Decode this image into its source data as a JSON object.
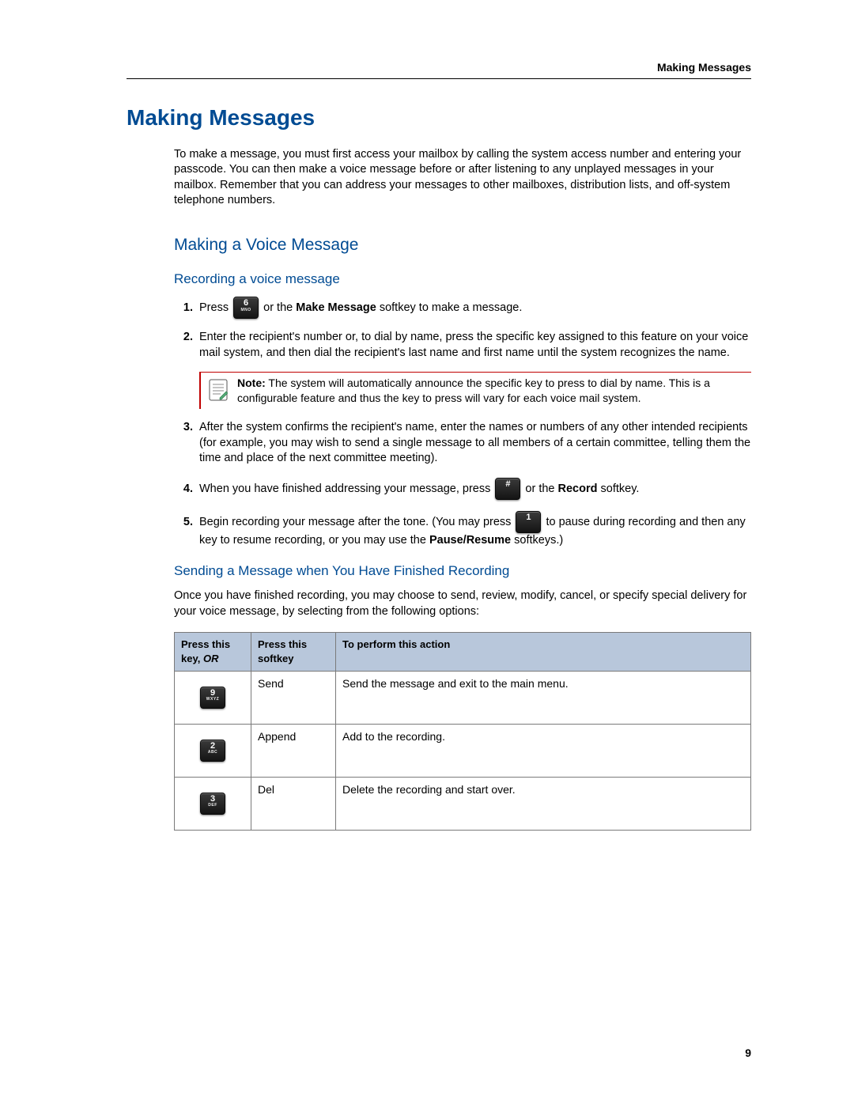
{
  "running_head": "Making Messages",
  "h1": "Making Messages",
  "intro": "To make a message, you must first access your mailbox by calling the system access number and entering your passcode. You can then make a voice message before or after listening to any unplayed messages in your mailbox. Remember that you can address your messages to other mailboxes, distribution lists, and off-system telephone numbers.",
  "h2": "Making a Voice Message",
  "h3a": "Recording a voice message",
  "steps": {
    "s1_a": "Press ",
    "s1_key_main": "6",
    "s1_key_sub": "MNO",
    "s1_b": " or the ",
    "s1_bold": "Make Message",
    "s1_c": " softkey to make a message.",
    "s2": "Enter the recipient's number or, to dial by name, press the specific key assigned to this feature on your voice mail system, and then dial the recipient's last name and first name until the system recognizes the name.",
    "note_label": "Note:",
    "note_body": " The system will automatically announce the specific key to press to dial by name. This is a configurable feature and thus the key to press will vary for each voice mail system.",
    "s3": "After the system confirms the recipient's name, enter the names or numbers of any other intended recipients (for example, you may wish to send a single message to all members of a certain committee, telling them the time and place of the next committee meeting).",
    "s4_a": "When you have finished addressing your message, press ",
    "s4_key_main": "#",
    "s4_b": " or the ",
    "s4_bold": "Record",
    "s4_c": " softkey.",
    "s5_a": "Begin recording your message after the tone. (You may press ",
    "s5_key_main": "1",
    "s5_b": " to pause during recording and then any key to resume recording, or you may use the ",
    "s5_bold": "Pause/Resume",
    "s5_c": " softkeys.)"
  },
  "h3b": "Sending a Message when You Have Finished Recording",
  "after": "Once you have finished recording, you may choose to send, review, modify, cancel, or specify special delivery for your voice message, by selecting from the following options:",
  "table": {
    "headers": {
      "c1a": "Press this key, ",
      "c1b": "OR",
      "c2": "Press this softkey",
      "c3": "To perform this action"
    },
    "rows": [
      {
        "key_main": "9",
        "key_sub": "WXYZ",
        "softkey": "Send",
        "action": "Send the message and exit to the main menu."
      },
      {
        "key_main": "2",
        "key_sub": "ABC",
        "softkey": "Append",
        "action": "Add to the recording."
      },
      {
        "key_main": "3",
        "key_sub": "DEF",
        "softkey": "Del",
        "action": "Delete the recording and start over."
      }
    ]
  },
  "page_number": "9"
}
